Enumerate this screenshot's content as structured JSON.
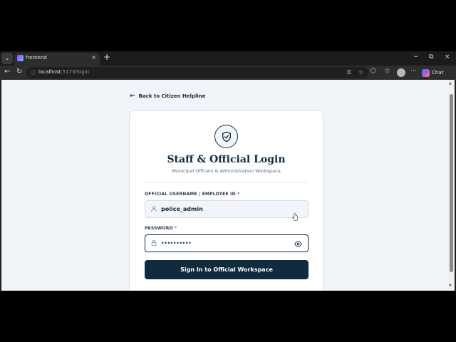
{
  "browser": {
    "tab_title": "frontend",
    "tab_close": "×",
    "new_tab": "+",
    "url_host": "localhost",
    "url_path": ":5173/login",
    "chat_label": "Chat",
    "window_controls": {
      "minimize": "−",
      "restore": "⧉",
      "close": "×"
    }
  },
  "page": {
    "back_link": "Back to Citizen Helpline",
    "title": "Staff & Official Login",
    "subtitle": "Municipal Officers & Administration Workspace",
    "username": {
      "label": "OFFICIAL USERNAME / EMPLOYEE ID",
      "required_mark": "*",
      "value": "police_admin"
    },
    "password": {
      "label": "PASSWORD",
      "required_mark": "*",
      "value_masked": "••••••••••"
    },
    "submit_label": "Sign In to Official Workspace"
  },
  "colors": {
    "primary": "#0f2b3d",
    "background": "#f1f5f9",
    "required": "#d14343"
  }
}
